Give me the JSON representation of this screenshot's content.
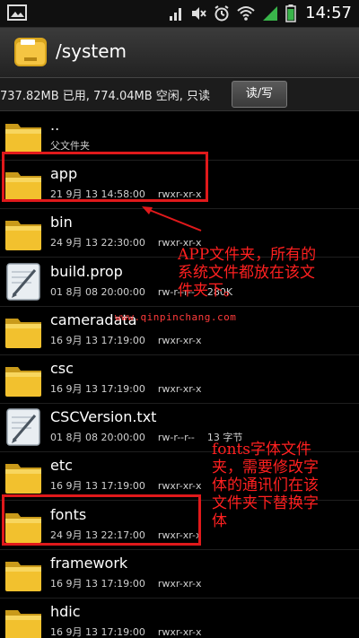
{
  "status_bar": {
    "time": "14:57",
    "icons": [
      "image-icon",
      "signal-bars-icon",
      "mute-icon",
      "alarm-icon",
      "wifi-icon",
      "network-signal-icon",
      "battery-icon"
    ]
  },
  "header": {
    "path": "/system",
    "icon": "folder-app-icon"
  },
  "info_bar": {
    "storage_text": "737.82MB 已用, 774.04MB 空闲, 只读",
    "rw_button_label": "读/写"
  },
  "files": [
    {
      "name": "..",
      "subtitle": "父文件夹",
      "type": "folder"
    },
    {
      "name": "app",
      "date": "21 9月 13 14:58:00",
      "perm": "rwxr-xr-x",
      "type": "folder"
    },
    {
      "name": "bin",
      "date": "24 9月 13 22:30:00",
      "perm": "rwxr-xr-x",
      "type": "folder"
    },
    {
      "name": "build.prop",
      "date": "01 8月 08 20:00:00",
      "perm": "rw-r--r--",
      "size": "280K",
      "type": "file"
    },
    {
      "name": "cameradata",
      "date": "16 9月 13 17:19:00",
      "perm": "rwxr-xr-x",
      "type": "folder"
    },
    {
      "name": "csc",
      "date": "16 9月 13 17:19:00",
      "perm": "rwxr-xr-x",
      "type": "folder"
    },
    {
      "name": "CSCVersion.txt",
      "date": "01 8月 08 20:00:00",
      "perm": "rw-r--r--",
      "size": "13 字节",
      "type": "file"
    },
    {
      "name": "etc",
      "date": "16 9月 13 17:19:00",
      "perm": "rwxr-xr-x",
      "type": "folder"
    },
    {
      "name": "fonts",
      "date": "24 9月 13 22:17:00",
      "perm": "rwxr-xr-x",
      "type": "folder"
    },
    {
      "name": "framework",
      "date": "16 9月 13 17:19:00",
      "perm": "rwxr-xr-x",
      "type": "folder"
    },
    {
      "name": "hdic",
      "date": "16 9月 13 17:19:00",
      "perm": "rwxr-xr-x",
      "type": "folder"
    }
  ],
  "annotations": {
    "app_note": [
      "APP文件夹，所有的",
      "系统文件都放在该文",
      "件夹下。"
    ],
    "fonts_note": [
      "fonts字体文件",
      "夹，需要修改字",
      "体的通讯们在该",
      "文件夹下替换字",
      "体"
    ],
    "watermark": "www.qinpinchang.com",
    "highlight_color": "#e0191b"
  }
}
